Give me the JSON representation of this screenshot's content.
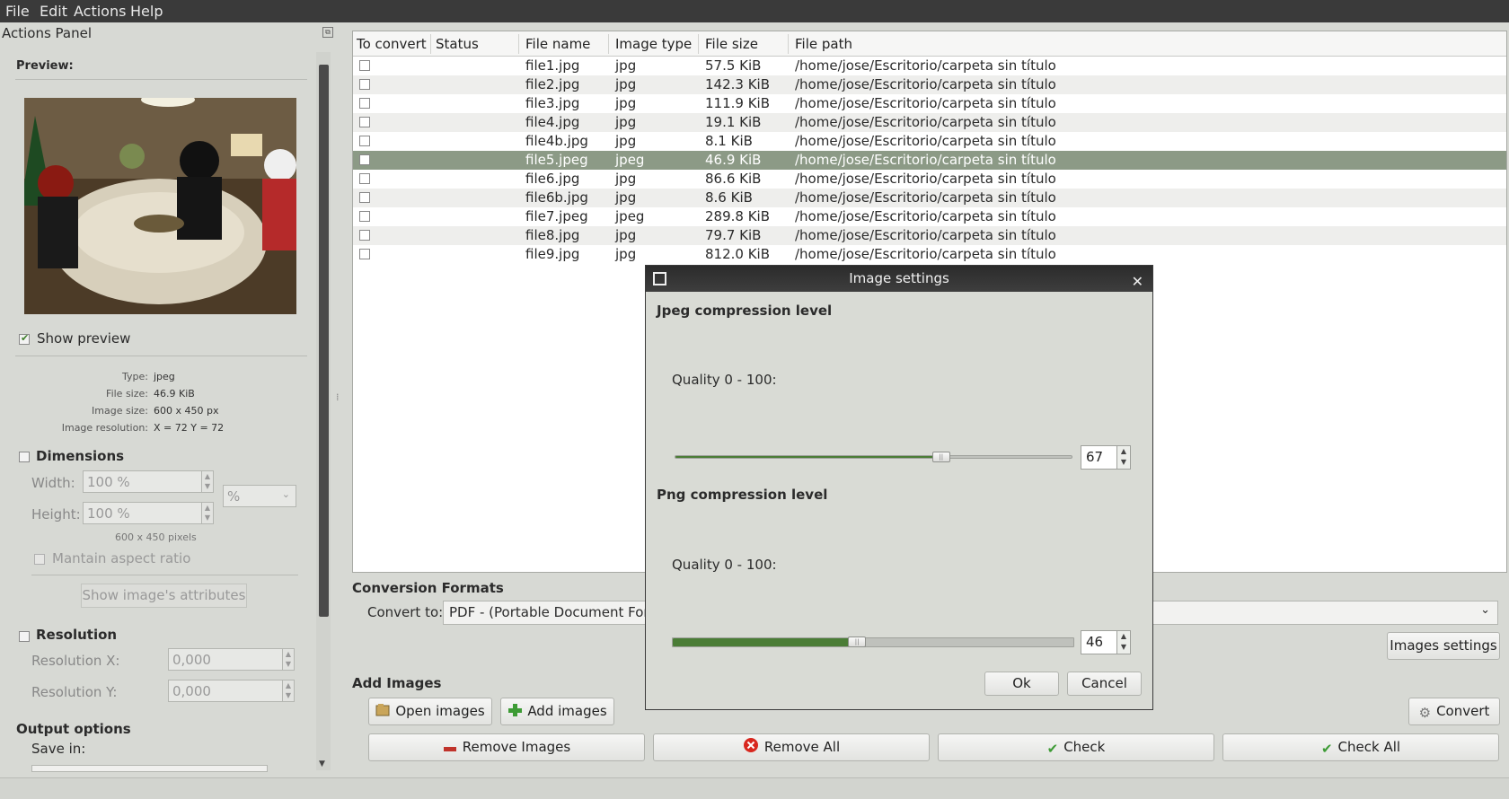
{
  "menu": [
    "File",
    "Edit",
    "Actions",
    "Help"
  ],
  "panel": {
    "title": "Actions Panel",
    "preview_label": "Preview:",
    "show_preview_label": "Show preview",
    "info": {
      "type_label": "Type:",
      "type_value": "jpeg",
      "filesize_label": "File size:",
      "filesize_value": "46.9 KiB",
      "imagesize_label": "Image size:",
      "imagesize_value": "600 x 450 px",
      "resolution_label": "Image resolution:",
      "resolution_value": "X = 72 Y = 72"
    },
    "dimensions": {
      "title": "Dimensions",
      "width_label": "Width:",
      "width_value": "100 %",
      "height_label": "Height:",
      "height_value": "100 %",
      "unit_value": "%",
      "pixels_note": "600 x 450 pixels",
      "aspect_label": "Mantain aspect ratio",
      "attributes_button": "Show image's attributes"
    },
    "resolution": {
      "title": "Resolution",
      "x_label": "Resolution X:",
      "x_value": "0,000",
      "y_label": "Resolution Y:",
      "y_value": "0,000"
    },
    "output": {
      "title": "Output options",
      "save_in_label": "Save in:"
    }
  },
  "table": {
    "columns": [
      "To convert",
      "Status",
      "File name",
      "Image type",
      "File size",
      "File path"
    ],
    "rows": [
      {
        "name": "file1.jpg",
        "type": "jpg",
        "size": "57.5 KiB",
        "path": "/home/jose/Escritorio/carpeta sin título"
      },
      {
        "name": "file2.jpg",
        "type": "jpg",
        "size": "142.3 KiB",
        "path": "/home/jose/Escritorio/carpeta sin título"
      },
      {
        "name": "file3.jpg",
        "type": "jpg",
        "size": "111.9 KiB",
        "path": "/home/jose/Escritorio/carpeta sin título"
      },
      {
        "name": "file4.jpg",
        "type": "jpg",
        "size": "19.1 KiB",
        "path": "/home/jose/Escritorio/carpeta sin título"
      },
      {
        "name": "file4b.jpg",
        "type": "jpg",
        "size": "8.1 KiB",
        "path": "/home/jose/Escritorio/carpeta sin título"
      },
      {
        "name": "file5.jpeg",
        "type": "jpeg",
        "size": "46.9 KiB",
        "path": "/home/jose/Escritorio/carpeta sin título",
        "selected": true
      },
      {
        "name": "file6.jpg",
        "type": "jpg",
        "size": "86.6 KiB",
        "path": "/home/jose/Escritorio/carpeta sin título"
      },
      {
        "name": "file6b.jpg",
        "type": "jpg",
        "size": "8.6 KiB",
        "path": "/home/jose/Escritorio/carpeta sin título"
      },
      {
        "name": "file7.jpeg",
        "type": "jpeg",
        "size": "289.8 KiB",
        "path": "/home/jose/Escritorio/carpeta sin título"
      },
      {
        "name": "file8.jpg",
        "type": "jpg",
        "size": "79.7 KiB",
        "path": "/home/jose/Escritorio/carpeta sin título"
      },
      {
        "name": "file9.jpg",
        "type": "jpg",
        "size": "812.0 KiB",
        "path": "/home/jose/Escritorio/carpeta sin título"
      }
    ]
  },
  "conversion": {
    "title": "Conversion Formats",
    "convert_to_label": "Convert to:",
    "convert_to_value": "PDF - (Portable Document Form",
    "images_settings_button": "Images settings"
  },
  "add_images": {
    "title": "Add Images",
    "open_button": "Open images",
    "add_button": "Add images",
    "convert_button": "Convert",
    "remove_images_button": "Remove Images",
    "remove_all_button": "Remove All",
    "check_button": "Check",
    "check_all_button": "Check All"
  },
  "dialog": {
    "title": "Image settings",
    "jpeg_title": "Jpeg compression level",
    "jpeg_quality_label": "Quality 0 - 100:",
    "jpeg_value": "67",
    "jpeg_level": 0.67,
    "png_title": "Png compression level",
    "png_quality_label": "Quality 0 - 100:",
    "png_value": "46",
    "png_level": 0.46,
    "ok_button": "Ok",
    "cancel_button": "Cancel"
  },
  "colors": {
    "accent": "#4b7d36",
    "selection": "#8c9a86",
    "titlebar": "#2b2b2b"
  }
}
